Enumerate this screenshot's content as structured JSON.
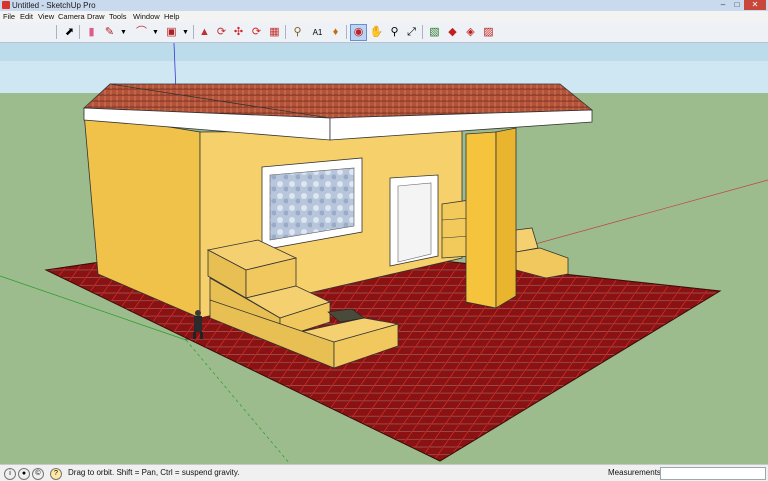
{
  "window": {
    "title": "Untitled - SketchUp Pro"
  },
  "menu": [
    "File",
    "Edit",
    "View",
    "Camera",
    "Draw",
    "Tools",
    "Window",
    "Help"
  ],
  "toolbar": {
    "icons": [
      "select-icon",
      "eraser-icon",
      "pencil-icon",
      "arc-icon",
      "rectangle-icon",
      "push-pull-icon",
      "follow-me-icon",
      "move-icon",
      "rotate-icon",
      "offset-icon",
      "tape-measure-icon",
      "text-icon",
      "paint-bucket-icon",
      "orbit-icon",
      "pan-icon",
      "zoom-icon",
      "zoom-extents-icon",
      "model-info-icon",
      "section-plane-icon",
      "component-icon",
      "share-icon",
      "warehouse-icon"
    ],
    "active": "orbit-icon"
  },
  "status": {
    "message": "Drag to orbit. Shift = Pan, Ctrl = suspend gravity."
  },
  "measurements": {
    "label": "Measurements",
    "value": ""
  },
  "colors": {
    "sky": "#cfe6f3",
    "ground": "#9dbc8d",
    "wall": "#f3c95b",
    "roof_tile": "#b4533a",
    "fascia": "#ffffff",
    "floor_tile": "#8a1212",
    "toolbar_active": "#bcd4f4"
  }
}
